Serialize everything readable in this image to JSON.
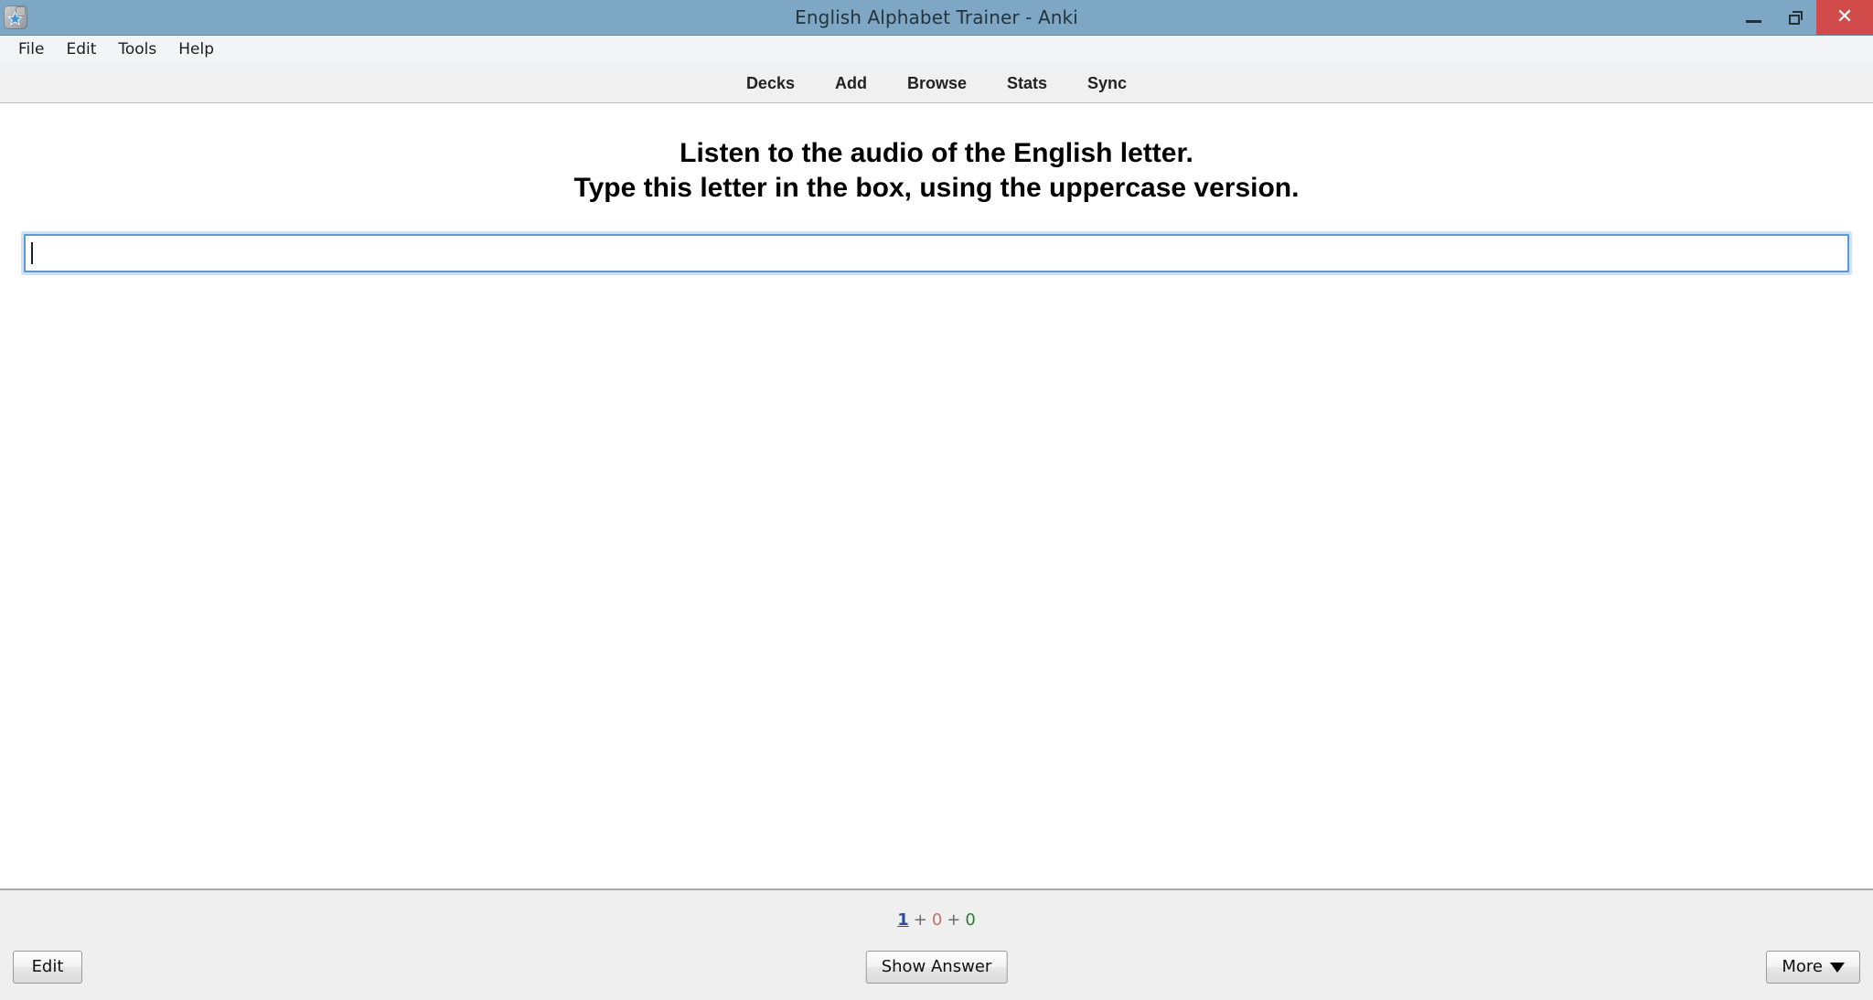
{
  "window": {
    "title": "English Alphabet Trainer - Anki",
    "icon": "anki-app-icon",
    "controls": {
      "minimize": "minimize-icon",
      "maximize": "restore-icon",
      "close": "close-icon"
    },
    "titlebar_color": "#7da7c4",
    "close_button_color": "#d24b4b"
  },
  "menubar": {
    "items": [
      {
        "label": "File"
      },
      {
        "label": "Edit"
      },
      {
        "label": "Tools"
      },
      {
        "label": "Help"
      }
    ]
  },
  "toolbar": {
    "items": [
      {
        "label": "Decks"
      },
      {
        "label": "Add"
      },
      {
        "label": "Browse"
      },
      {
        "label": "Stats"
      },
      {
        "label": "Sync"
      }
    ]
  },
  "card": {
    "question_line1": "Listen to the audio of the English letter.",
    "question_line2": "Type this letter in the box, using the uppercase version.",
    "answer_input": {
      "value": "",
      "placeholder": ""
    }
  },
  "status": {
    "new_count": "1",
    "learn_count": "0",
    "due_count": "0",
    "separator": "+",
    "new_color": "#2b4f9e",
    "learn_color": "#c0766a",
    "due_color": "#2e7d32"
  },
  "bottom_buttons": {
    "edit_label": "Edit",
    "show_answer_label": "Show Answer",
    "more_label": "More",
    "more_icon": "chevron-down-icon"
  }
}
